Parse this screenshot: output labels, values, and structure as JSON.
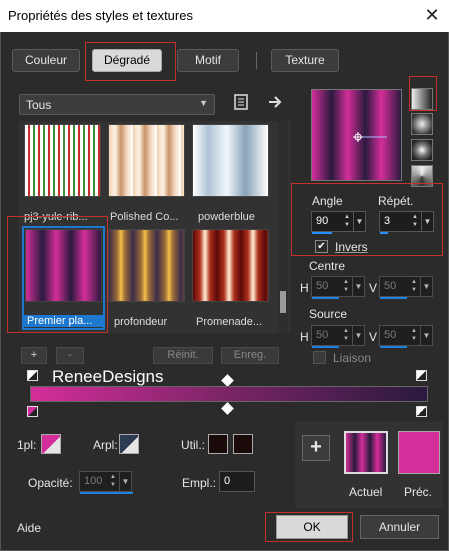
{
  "window": {
    "title": "Propriétés des styles et textures",
    "close_glyph": "✕"
  },
  "tabs": [
    {
      "label": "Couleur",
      "active": false
    },
    {
      "label": "Dégradé",
      "active": true
    },
    {
      "label": "Motif",
      "active": false
    },
    {
      "label": "Texture",
      "active": false
    }
  ],
  "category_dropdown": {
    "value": "Tous"
  },
  "gradient_thumbnails": [
    {
      "name": "pj3-yule-rib...",
      "selected": false
    },
    {
      "name": "Polished Co...",
      "selected": false
    },
    {
      "name": "powderblue",
      "selected": false
    },
    {
      "name": "Premier pla...",
      "selected": true
    },
    {
      "name": "profondeur",
      "selected": false
    },
    {
      "name": "Promenade...",
      "selected": false
    }
  ],
  "list_buttons": {
    "add": "+",
    "remove": "-",
    "reset": "Réinit.",
    "save": "Enreg."
  },
  "angle": {
    "label": "Angle",
    "value": "90"
  },
  "repeat": {
    "label": "Répét.",
    "value": "3"
  },
  "invert": {
    "label": "Invers",
    "checked": true
  },
  "center": {
    "label": "Centre",
    "h_label": "H",
    "h_value": "50",
    "v_label": "V",
    "v_value": "50"
  },
  "source": {
    "label": "Source",
    "h_label": "H",
    "h_value": "50",
    "v_label": "V",
    "v_value": "50"
  },
  "link": {
    "label": "Liaison",
    "checked": false
  },
  "gradient_bar": {
    "watermark": "ReneeDesigns"
  },
  "stop_props": {
    "foreground_label": "1pl:",
    "background_label": "Arpl:",
    "user_label": "Util.:",
    "opacity_label": "Opacité:",
    "opacity_value": "100",
    "location_label": "Empl.:",
    "location_value": "0"
  },
  "preview_panel": {
    "add_glyph": "+",
    "current_label": "Actuel",
    "previous_label": "Préc."
  },
  "footer": {
    "help": "Aide",
    "ok": "OK",
    "cancel": "Annuler"
  },
  "colors": {
    "magenta": "#d42e9a",
    "dark_purple": "#2a1a3e",
    "selection_blue": "#1e78d0",
    "highlight_red": "#c4302b"
  }
}
